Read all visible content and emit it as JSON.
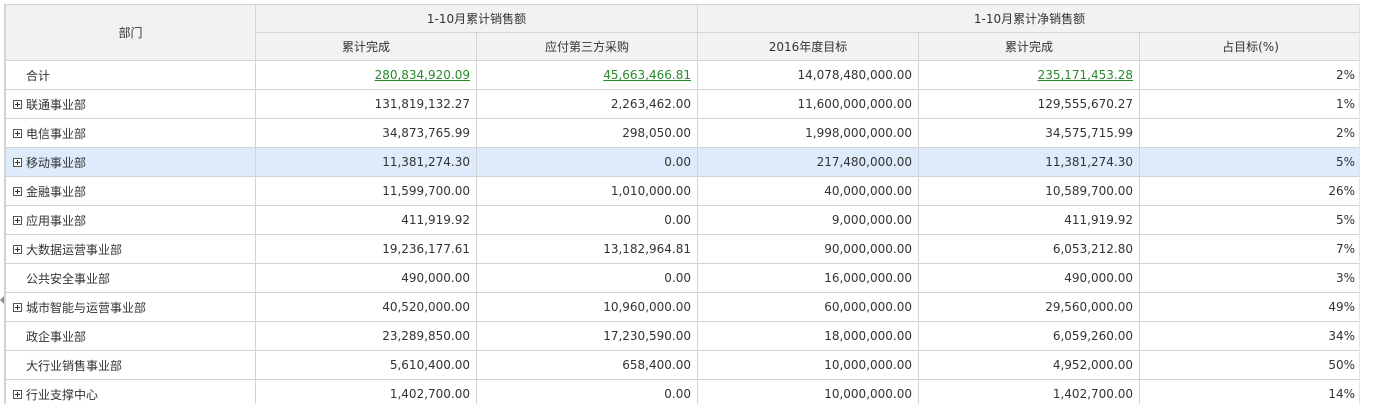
{
  "header": {
    "dept": "部门",
    "group_sales": "1-10月累计销售额",
    "group_net": "1-10月累计净销售额",
    "col_cum": "累计完成",
    "col_third": "应付第三方采购",
    "col_target": "2016年度目标",
    "col_net_cum": "累计完成",
    "col_pct": "占目标(%)"
  },
  "rows": [
    {
      "dept": "合计",
      "expand": false,
      "cum": "280,834,920.09",
      "third": "45,663,466.81",
      "target": "14,078,480,000.00",
      "net": "235,171,453.28",
      "pct": "2%"
    },
    {
      "dept": "联通事业部",
      "expand": true,
      "cum": "131,819,132.27",
      "third": "2,263,462.00",
      "target": "11,600,000,000.00",
      "net": "129,555,670.27",
      "pct": "1%"
    },
    {
      "dept": "电信事业部",
      "expand": true,
      "cum": "34,873,765.99",
      "third": "298,050.00",
      "target": "1,998,000,000.00",
      "net": "34,575,715.99",
      "pct": "2%"
    },
    {
      "dept": "移动事业部",
      "expand": true,
      "selected": true,
      "cum": "11,381,274.30",
      "third": "0.00",
      "target": "217,480,000.00",
      "net": "11,381,274.30",
      "pct": "5%"
    },
    {
      "dept": "金融事业部",
      "expand": true,
      "cum": "11,599,700.00",
      "third": "1,010,000.00",
      "target": "40,000,000.00",
      "net": "10,589,700.00",
      "pct": "26%"
    },
    {
      "dept": "应用事业部",
      "expand": true,
      "cum": "411,919.92",
      "third": "0.00",
      "target": "9,000,000.00",
      "net": "411,919.92",
      "pct": "5%"
    },
    {
      "dept": "大数据运营事业部",
      "expand": true,
      "cum": "19,236,177.61",
      "third": "13,182,964.81",
      "target": "90,000,000.00",
      "net": "6,053,212.80",
      "pct": "7%"
    },
    {
      "dept": "公共安全事业部",
      "expand": false,
      "cum": "490,000.00",
      "third": "0.00",
      "target": "16,000,000.00",
      "net": "490,000.00",
      "pct": "3%"
    },
    {
      "dept": "城市智能与运营事业部",
      "expand": true,
      "cum": "40,520,000.00",
      "third": "10,960,000.00",
      "target": "60,000,000.00",
      "net": "29,560,000.00",
      "pct": "49%"
    },
    {
      "dept": "政企事业部",
      "expand": false,
      "cum": "23,289,850.00",
      "third": "17,230,590.00",
      "target": "18,000,000.00",
      "net": "6,059,260.00",
      "pct": "34%"
    },
    {
      "dept": "大行业销售事业部",
      "expand": false,
      "cum": "5,610,400.00",
      "third": "658,400.00",
      "target": "10,000,000.00",
      "net": "4,952,000.00",
      "pct": "50%"
    },
    {
      "dept": "行业支撑中心",
      "expand": true,
      "cum": "1,402,700.00",
      "third": "0.00",
      "target": "10,000,000.00",
      "net": "1,402,700.00",
      "pct": "14%"
    }
  ],
  "colors": {
    "link": "#2a8a2a",
    "header_bg": "#f2f2f2",
    "selected_bg": "#ddebfb",
    "grid": "#d4d4d4"
  }
}
